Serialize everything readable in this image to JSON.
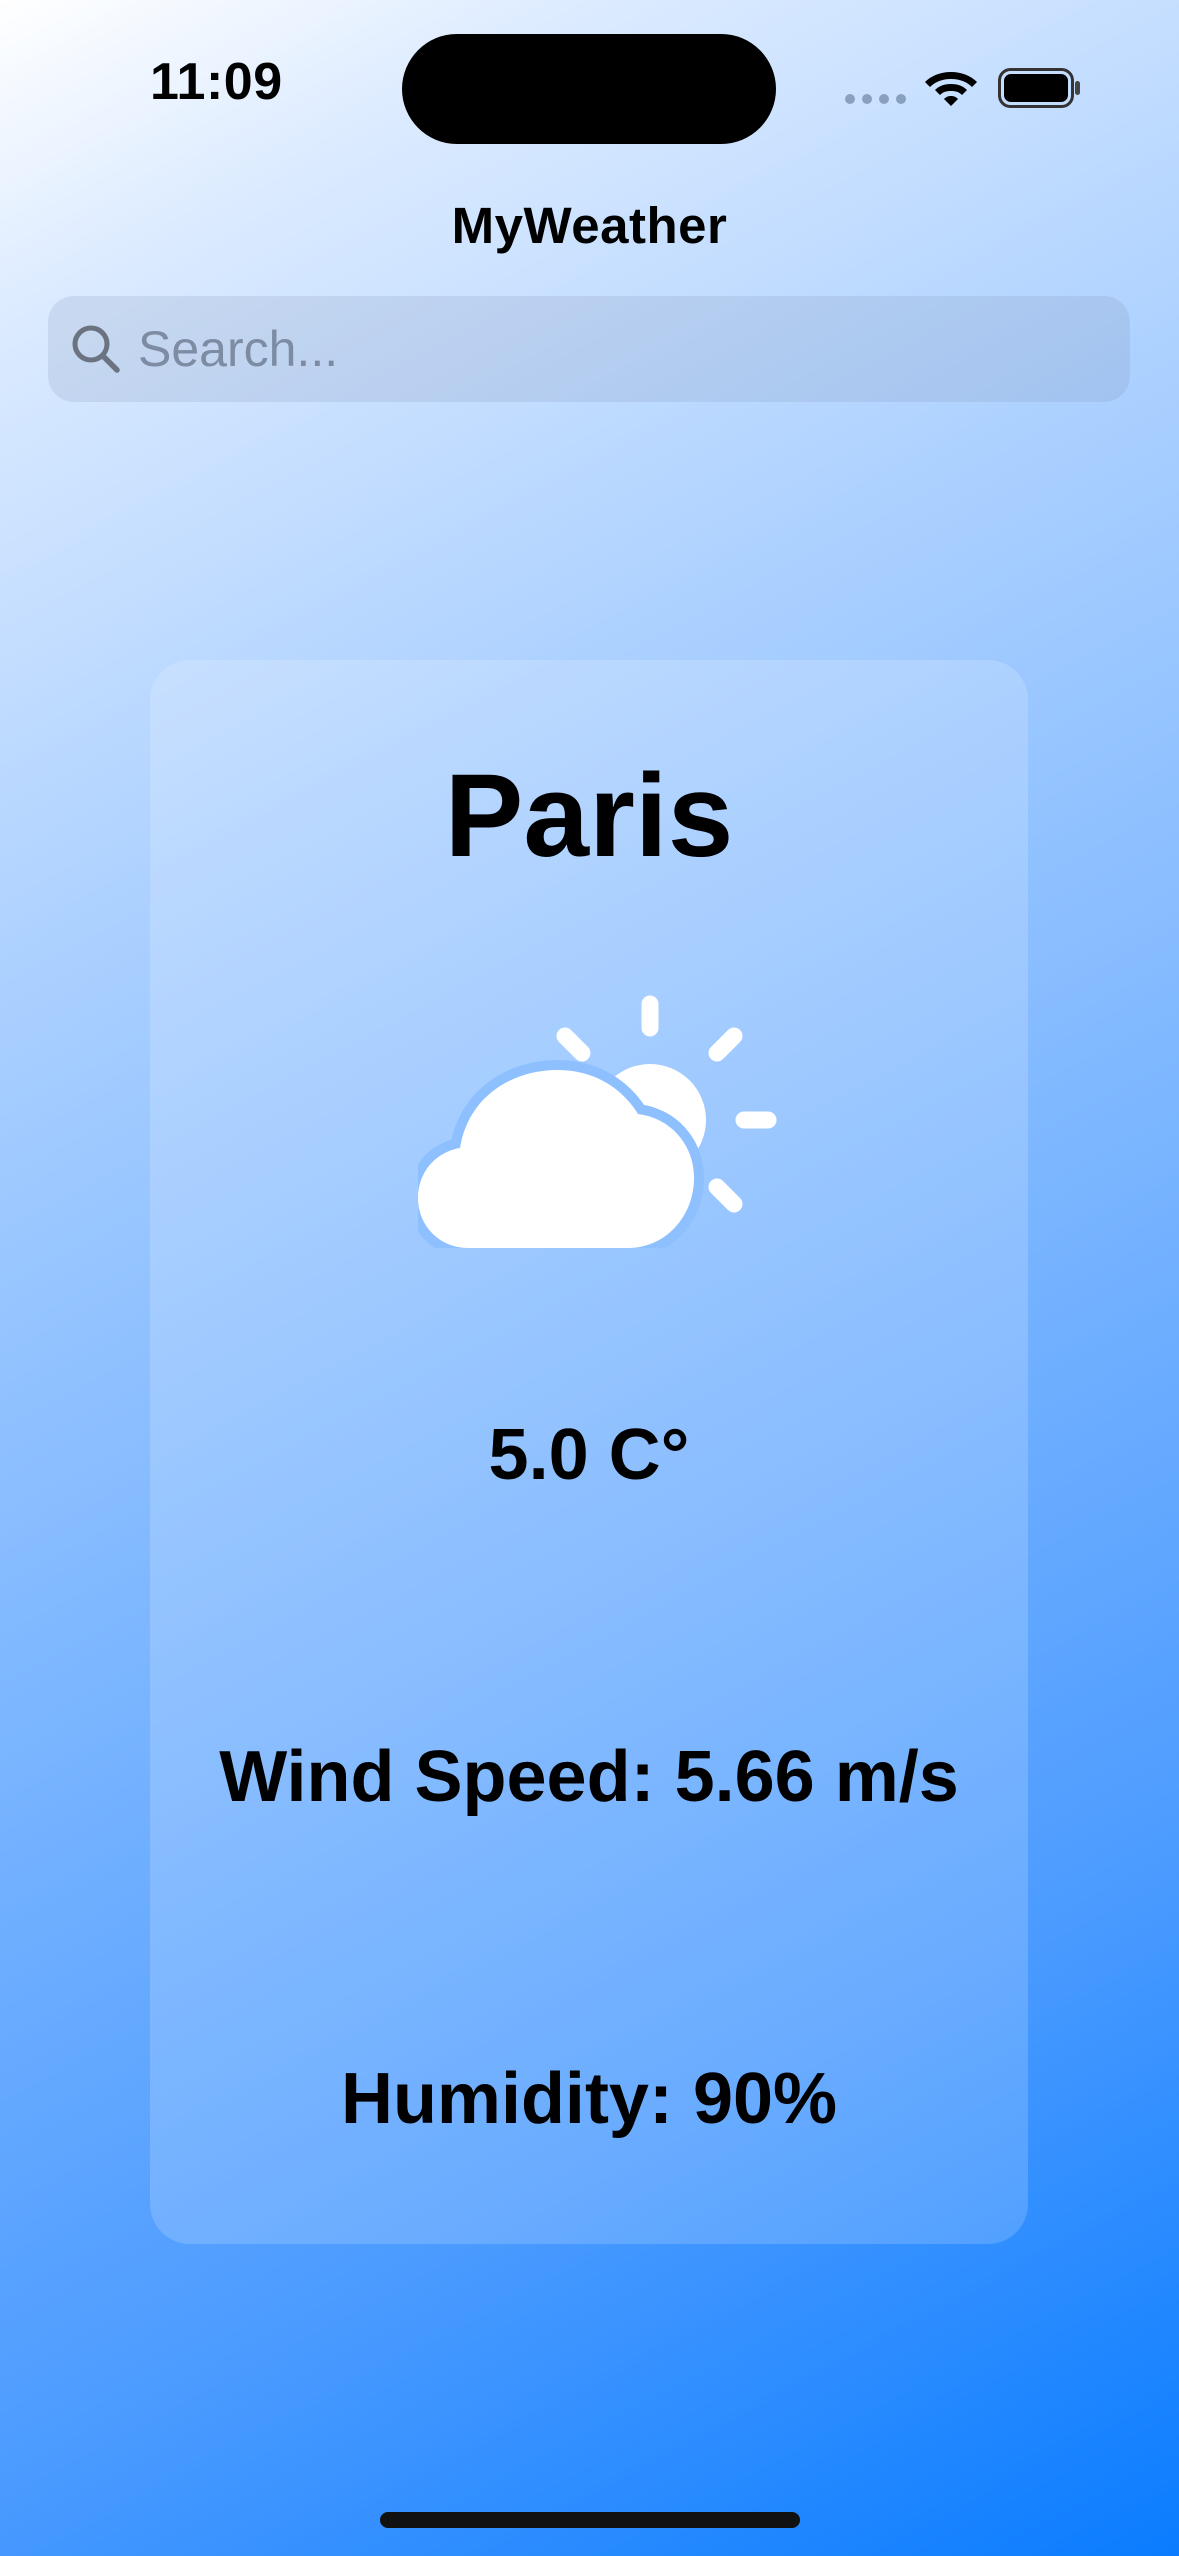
{
  "status_bar": {
    "time": "11:09"
  },
  "nav": {
    "title": "MyWeather"
  },
  "search": {
    "placeholder": "Search...",
    "value": ""
  },
  "weather": {
    "city": "Paris",
    "condition_icon": "cloud-sun-icon",
    "temperature": "5.0 C°",
    "wind_speed": "Wind Speed: 5.66 m/s",
    "humidity": "Humidity: 90%"
  },
  "colors": {
    "background_start": "#ffffff",
    "background_end": "#0a7cff",
    "text": "#000000",
    "icon": "#ffffff"
  }
}
